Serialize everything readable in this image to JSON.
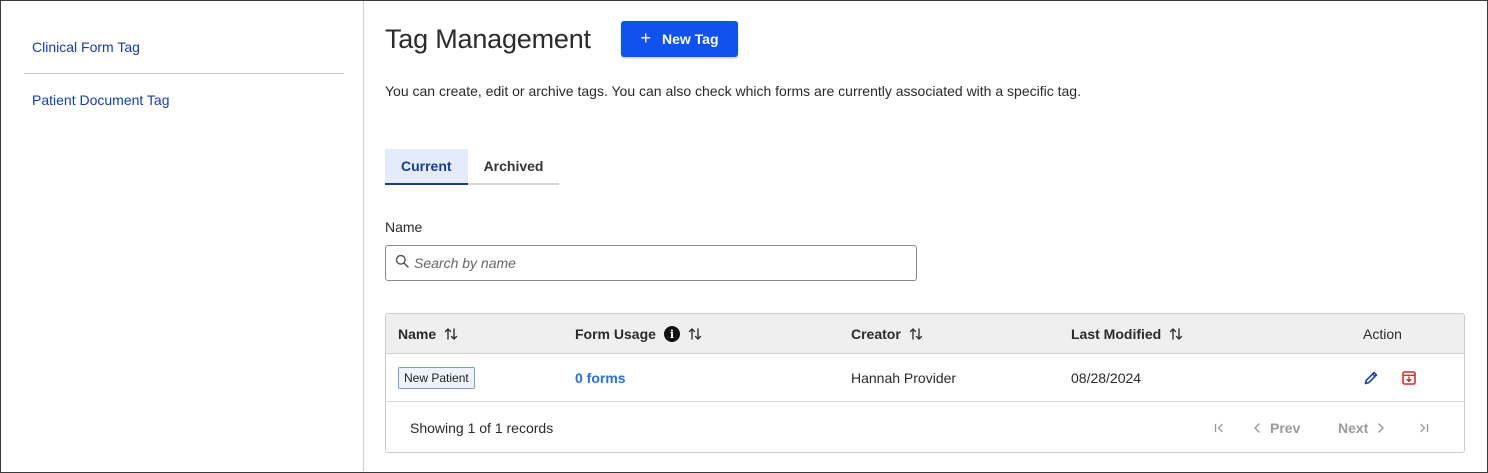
{
  "sidebar": {
    "items": [
      {
        "label": "Clinical Form Tag"
      },
      {
        "label": "Patient Document Tag"
      }
    ]
  },
  "header": {
    "title": "Tag Management",
    "new_button_label": "New Tag",
    "description": "You can create, edit or archive tags. You can also check which forms are currently associated with a specific tag."
  },
  "tabs": [
    {
      "label": "Current",
      "active": true
    },
    {
      "label": "Archived",
      "active": false
    }
  ],
  "filter": {
    "label": "Name",
    "placeholder": "Search by name",
    "value": ""
  },
  "table": {
    "columns": [
      "Name",
      "Form Usage",
      "Creator",
      "Last Modified",
      "Action"
    ],
    "rows": [
      {
        "name": "New Patient",
        "form_usage": "0 forms",
        "creator": "Hannah Provider",
        "last_modified": "08/28/2024"
      }
    ],
    "footer": "Showing 1 of 1 records",
    "pagination": {
      "prev": "Prev",
      "next": "Next"
    }
  },
  "icons": {
    "new_button": "plus-icon",
    "search": "search-icon",
    "sort": "sort-icon",
    "info": "info-icon",
    "edit": "pencil-icon",
    "archive": "archive-icon",
    "first": "first-page-icon",
    "last": "last-page-icon"
  },
  "colors": {
    "primary": "#1052f0",
    "link": "#2a6fe0",
    "sidebar_link": "#1640a8",
    "active_tab_bg": "#e4ecfb",
    "archive_red": "#d32f2f"
  }
}
